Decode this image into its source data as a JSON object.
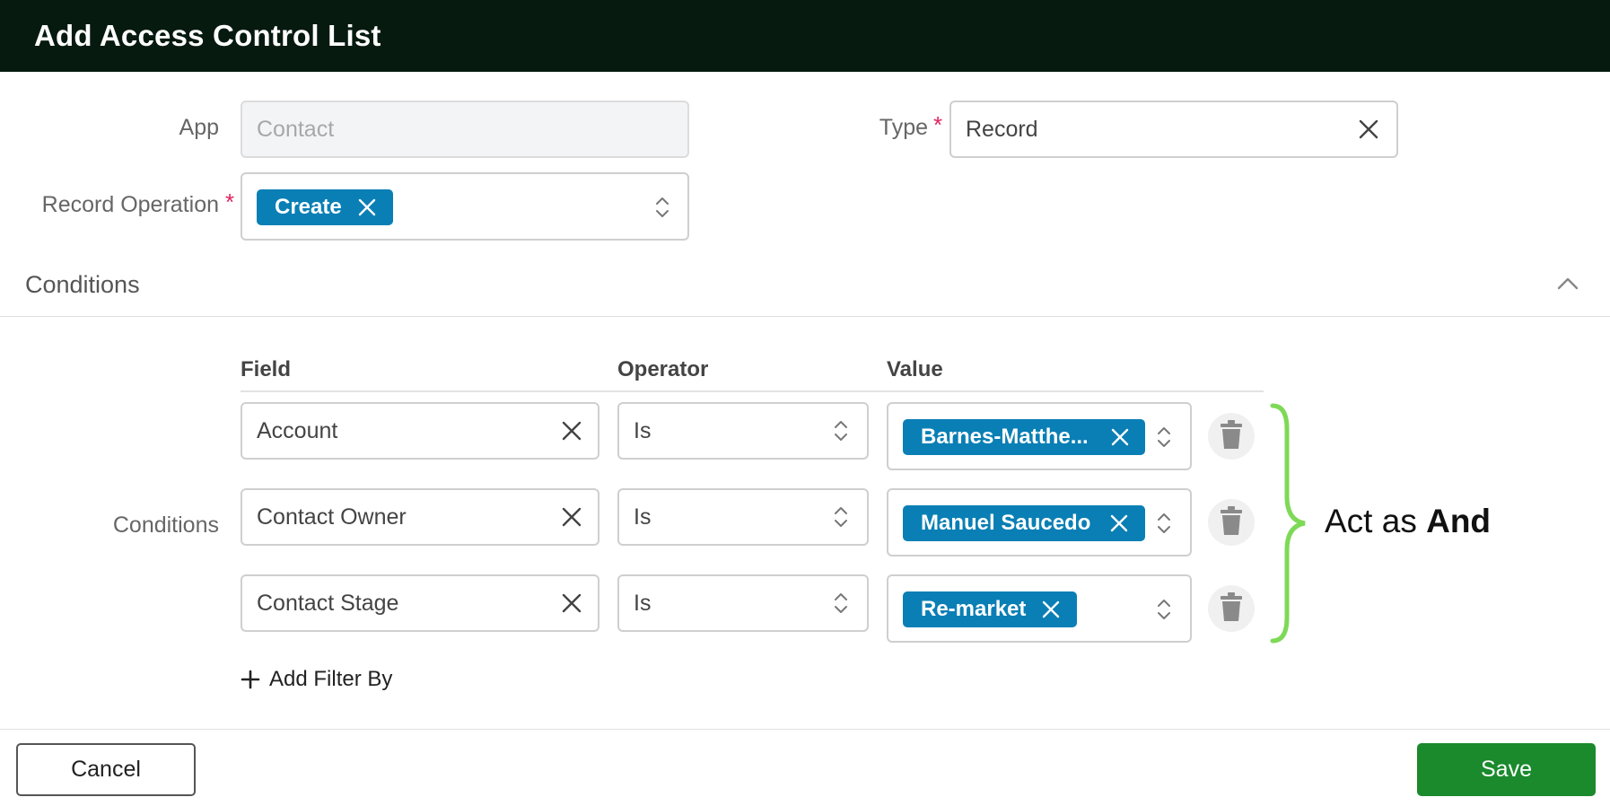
{
  "header": {
    "title": "Add Access Control List"
  },
  "form": {
    "app": {
      "label": "App",
      "value": "Contact"
    },
    "type": {
      "label": "Type",
      "required": "*",
      "value": "Record"
    },
    "record_operation": {
      "label": "Record Operation",
      "required": "*",
      "chips": [
        "Create"
      ]
    }
  },
  "conditions_section": {
    "title": "Conditions",
    "row_label": "Conditions",
    "columns": {
      "field": "Field",
      "operator": "Operator",
      "value": "Value"
    },
    "rows": [
      {
        "field": "Account",
        "operator": "Is",
        "value_chip": "Barnes-Matthe..."
      },
      {
        "field": "Contact Owner",
        "operator": "Is",
        "value_chip": "Manuel Saucedo"
      },
      {
        "field": "Contact Stage",
        "operator": "Is",
        "value_chip": "Re-market"
      }
    ],
    "add_filter_label": "Add Filter By"
  },
  "annotation": {
    "prefix": "Act as",
    "emphasis": "And",
    "brace_color": "#7ed957"
  },
  "footer": {
    "cancel_label": "Cancel",
    "save_label": "Save"
  },
  "colors": {
    "header_bg": "#061a0f",
    "chip_bg": "#0a7fb5",
    "save_bg": "#1a8a2c",
    "required": "#e0245e"
  },
  "icons": [
    "close-icon",
    "updown-icon",
    "chevron-up-icon",
    "trash-icon",
    "plus-icon"
  ]
}
